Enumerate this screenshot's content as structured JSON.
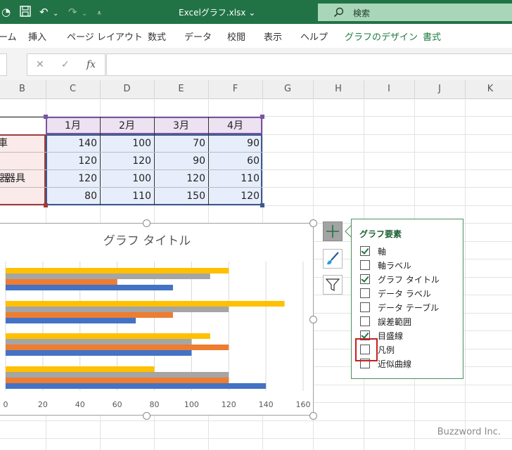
{
  "window": {
    "file_name": "Excelグラフ.xlsx ⌄",
    "search_label": "検索",
    "icons": [
      "save-icon",
      "undo-icon",
      "redo-icon",
      "customize-qat-icon",
      "search-icon"
    ]
  },
  "ribbon": {
    "tabs": [
      "ーム",
      "挿入",
      "ページ レイアウト",
      "数式",
      "データ",
      "校閲",
      "表示",
      "ヘルプ",
      "グラフのデザイン",
      "書式"
    ],
    "accent_tabs": [
      "グラフのデザイン",
      "書式"
    ],
    "accent_color": "#1b7a3e"
  },
  "formula_bar": {
    "cancel": "✕",
    "enter": "✓",
    "fx": "fx",
    "value": ""
  },
  "grid": {
    "columns": [
      "B",
      "C",
      "D",
      "E",
      "F",
      "G",
      "H",
      "I",
      "J",
      "K"
    ],
    "months": [
      "1月",
      "2月",
      "3月",
      "4月"
    ],
    "rows": [
      {
        "label": "車",
        "values": [
          140,
          100,
          70,
          90
        ]
      },
      {
        "label": "",
        "values": [
          120,
          120,
          90,
          60
        ]
      },
      {
        "label": "器具",
        "values": [
          120,
          100,
          120,
          110
        ]
      },
      {
        "label": "",
        "values": [
          80,
          110,
          150,
          120
        ]
      }
    ]
  },
  "chart_data": {
    "type": "bar",
    "orientation": "horizontal",
    "title": "グラフ タイトル",
    "series_colors": [
      "#4472C4",
      "#ED7D31",
      "#A5A5A5",
      "#FFC000"
    ],
    "groups": [
      {
        "values": [
          140,
          120,
          120,
          80
        ]
      },
      {
        "values": [
          100,
          120,
          100,
          110
        ]
      },
      {
        "values": [
          70,
          90,
          120,
          150
        ]
      },
      {
        "values": [
          90,
          60,
          110,
          120
        ]
      }
    ],
    "x_ticks": [
      0,
      20,
      40,
      60,
      80,
      100,
      120,
      140,
      160
    ],
    "xlim": [
      0,
      160
    ],
    "grid": true
  },
  "chart_elements_popup": {
    "title": "グラフ要素",
    "items": [
      {
        "label": "軸",
        "checked": true
      },
      {
        "label": "軸ラベル",
        "checked": false
      },
      {
        "label": "グラフ タイトル",
        "checked": true
      },
      {
        "label": "データ ラベル",
        "checked": false
      },
      {
        "label": "データ テーブル",
        "checked": false
      },
      {
        "label": "誤差範囲",
        "checked": false
      },
      {
        "label": "目盛線",
        "checked": true
      },
      {
        "label": "凡例",
        "checked": false
      },
      {
        "label": "近似曲線",
        "checked": false
      }
    ],
    "highlight_color": "#c8201f"
  },
  "chart_side_buttons": [
    "chart-elements-icon",
    "chart-styles-icon",
    "chart-filters-icon"
  ],
  "watermark": "Buzzword Inc."
}
